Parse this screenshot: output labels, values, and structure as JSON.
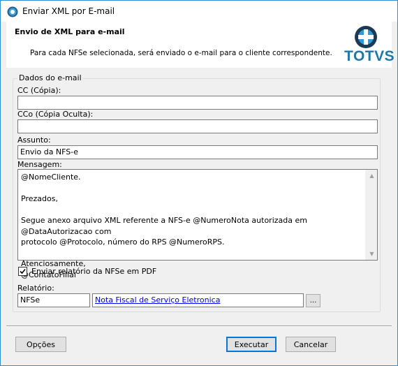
{
  "window": {
    "title": "Enviar XML por E-mail"
  },
  "header": {
    "title": "Envio de XML para e-mail",
    "description": "Para cada NFSe selecionada, será enviado o e-mail para o cliente correspondente.",
    "logo_text": "TOTVS",
    "brand_color": "#1f78a8"
  },
  "group": {
    "legend": "Dados do e-mail"
  },
  "fields": {
    "cc_label": "CC (Cópia):",
    "cc_value": "",
    "cco_label": "CCo (Cópia Oculta):",
    "cco_value": "",
    "subject_label": "Assunto:",
    "subject_value": "Envio da NFS-e",
    "message_label": "Mensagem:",
    "message_lines": [
      "@NomeCliente.",
      "",
      "Prezados,",
      "",
      "Segue anexo arquivo XML referente a NFS-e @NumeroNota autorizada em @DataAutorizacao com",
      "protocolo @Protocolo, número do RPS @NumeroRPS.",
      "",
      "Atenciosamente,",
      "@ContatoFilial"
    ]
  },
  "report": {
    "checkbox_label": "Enviar relatório da NFSe em PDF",
    "checked": true,
    "label": "Relatório:",
    "code": "NFSe",
    "description": "Nota Fiscal de Serviço Eletronica",
    "browse_label": "..."
  },
  "buttons": {
    "options": "Opções",
    "execute": "Executar",
    "cancel": "Cancelar"
  }
}
